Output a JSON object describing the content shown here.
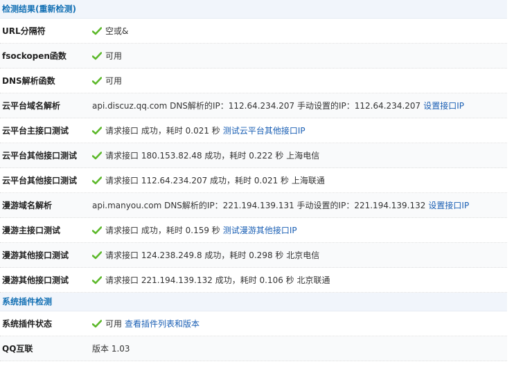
{
  "colors": {
    "header_text": "#1370b4",
    "link": "#1a5fb4",
    "check": "#5cb82a"
  },
  "sections": [
    {
      "title": "检测结果(重新检测)",
      "rows": [
        {
          "label": "URL分隔符",
          "check": true,
          "value": "空或&",
          "link": ""
        },
        {
          "label": "fsockopen函数",
          "check": true,
          "value": "可用",
          "link": ""
        },
        {
          "label": "DNS解析函数",
          "check": true,
          "value": "可用",
          "link": ""
        },
        {
          "label": "云平台域名解析",
          "check": false,
          "value": "api.discuz.qq.com DNS解析的IP：112.64.234.207 手动设置的IP：112.64.234.207",
          "link": "设置接口IP"
        },
        {
          "label": "云平台主接口测试",
          "check": true,
          "value": "请求接口 成功，耗时 0.021 秒",
          "link": "测试云平台其他接口IP"
        },
        {
          "label": "云平台其他接口测试",
          "check": true,
          "value": "请求接口 180.153.82.48 成功，耗时 0.222 秒 上海电信",
          "link": ""
        },
        {
          "label": "云平台其他接口测试",
          "check": true,
          "value": "请求接口 112.64.234.207 成功，耗时 0.021 秒 上海联通",
          "link": ""
        },
        {
          "label": "漫游域名解析",
          "check": false,
          "value": "api.manyou.com DNS解析的IP：221.194.139.131 手动设置的IP：221.194.139.132",
          "link": "设置接口IP"
        },
        {
          "label": "漫游主接口测试",
          "check": true,
          "value": "请求接口 成功，耗时 0.159 秒",
          "link": "测试漫游其他接口IP"
        },
        {
          "label": "漫游其他接口测试",
          "check": true,
          "value": "请求接口 124.238.249.8 成功，耗时 0.298 秒 北京电信",
          "link": ""
        },
        {
          "label": "漫游其他接口测试",
          "check": true,
          "value": "请求接口 221.194.139.132 成功，耗时 0.106 秒 北京联通",
          "link": ""
        }
      ]
    },
    {
      "title": "系统插件检测",
      "rows": [
        {
          "label": "系统插件状态",
          "check": true,
          "value": "可用",
          "link": "查看插件列表和版本"
        },
        {
          "label": "QQ互联",
          "check": false,
          "value": "版本 1.03",
          "link": ""
        }
      ]
    }
  ]
}
